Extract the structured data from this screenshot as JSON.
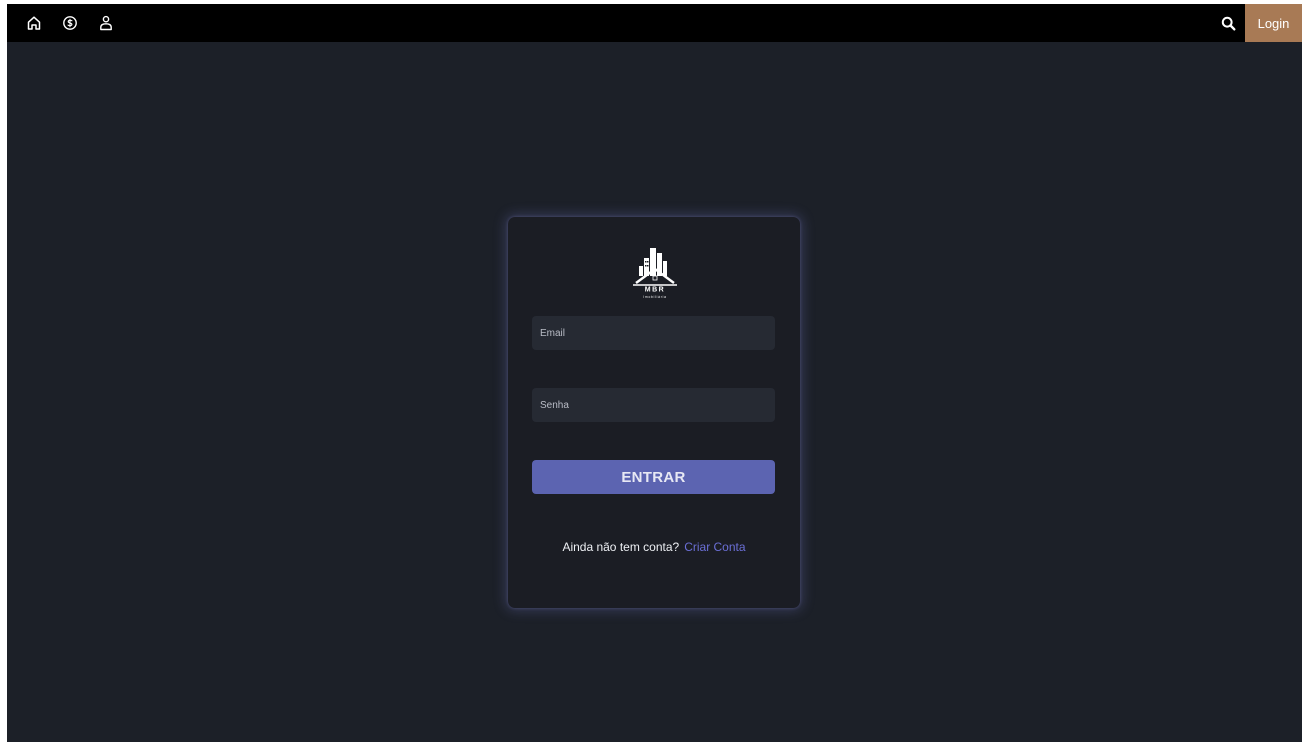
{
  "navbar": {
    "icons": [
      "home-icon",
      "dollar-circle-icon",
      "user-icon",
      "search-icon"
    ],
    "login_label": "Login",
    "login_bg": "#a87a55"
  },
  "login_card": {
    "logo_text": "MBR",
    "logo_subtext": "Imobiliária",
    "email_placeholder": "Email",
    "password_placeholder": "Senha",
    "submit_label": "ENTRAR",
    "submit_bg": "#5c64b1",
    "signup_prompt": "Ainda não tem conta?",
    "signup_link": "Criar Conta",
    "signup_link_color": "#6b6fd6"
  },
  "colors": {
    "page_bg": "#1c2028",
    "card_bg": "#1b1d24",
    "navbar_bg": "#000000"
  }
}
